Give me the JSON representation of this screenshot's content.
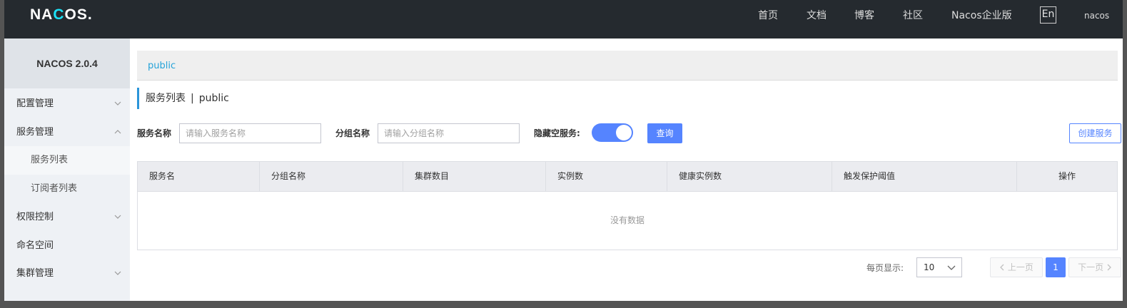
{
  "header": {
    "logo_text_pre": "NA",
    "logo_text_o": "C",
    "logo_text_post": "OS.",
    "nav": [
      "首页",
      "文档",
      "博客",
      "社区",
      "Nacos企业版"
    ],
    "lang": "En",
    "user": "nacos"
  },
  "sidebar": {
    "title": "NACOS 2.0.4",
    "items": [
      {
        "label": "配置管理",
        "chevron": "chevron-down-icon"
      },
      {
        "label": "服务管理",
        "chevron": "chevron-up-icon"
      },
      {
        "label": "服务列表"
      },
      {
        "label": "订阅者列表"
      },
      {
        "label": "权限控制",
        "chevron": "chevron-down-icon"
      },
      {
        "label": "命名空间"
      },
      {
        "label": "集群管理",
        "chevron": "chevron-down-icon"
      }
    ]
  },
  "main": {
    "namespace": "public",
    "title": "服务列表",
    "title_sep": "|",
    "title_ns": "public",
    "filters": {
      "service_label": "服务名称",
      "service_placeholder": "请输入服务名称",
      "group_label": "分组名称",
      "group_placeholder": "请输入分组名称",
      "hide_empty_label": "隐藏空服务:",
      "hide_empty_on": true,
      "query_button": "查询",
      "create_button": "创建服务"
    },
    "table": {
      "columns": [
        "服务名",
        "分组名称",
        "集群数目",
        "实例数",
        "健康实例数",
        "触发保护阈值",
        "操作"
      ],
      "empty_text": "没有数据"
    },
    "pagination": {
      "page_size_label": "每页显示:",
      "page_size": "10",
      "prev": "上一页",
      "current": "1",
      "next": "下一页"
    }
  },
  "colors": {
    "header_bg": "#252a2f",
    "accent": "#5584ff",
    "link": "#25a3d9"
  }
}
